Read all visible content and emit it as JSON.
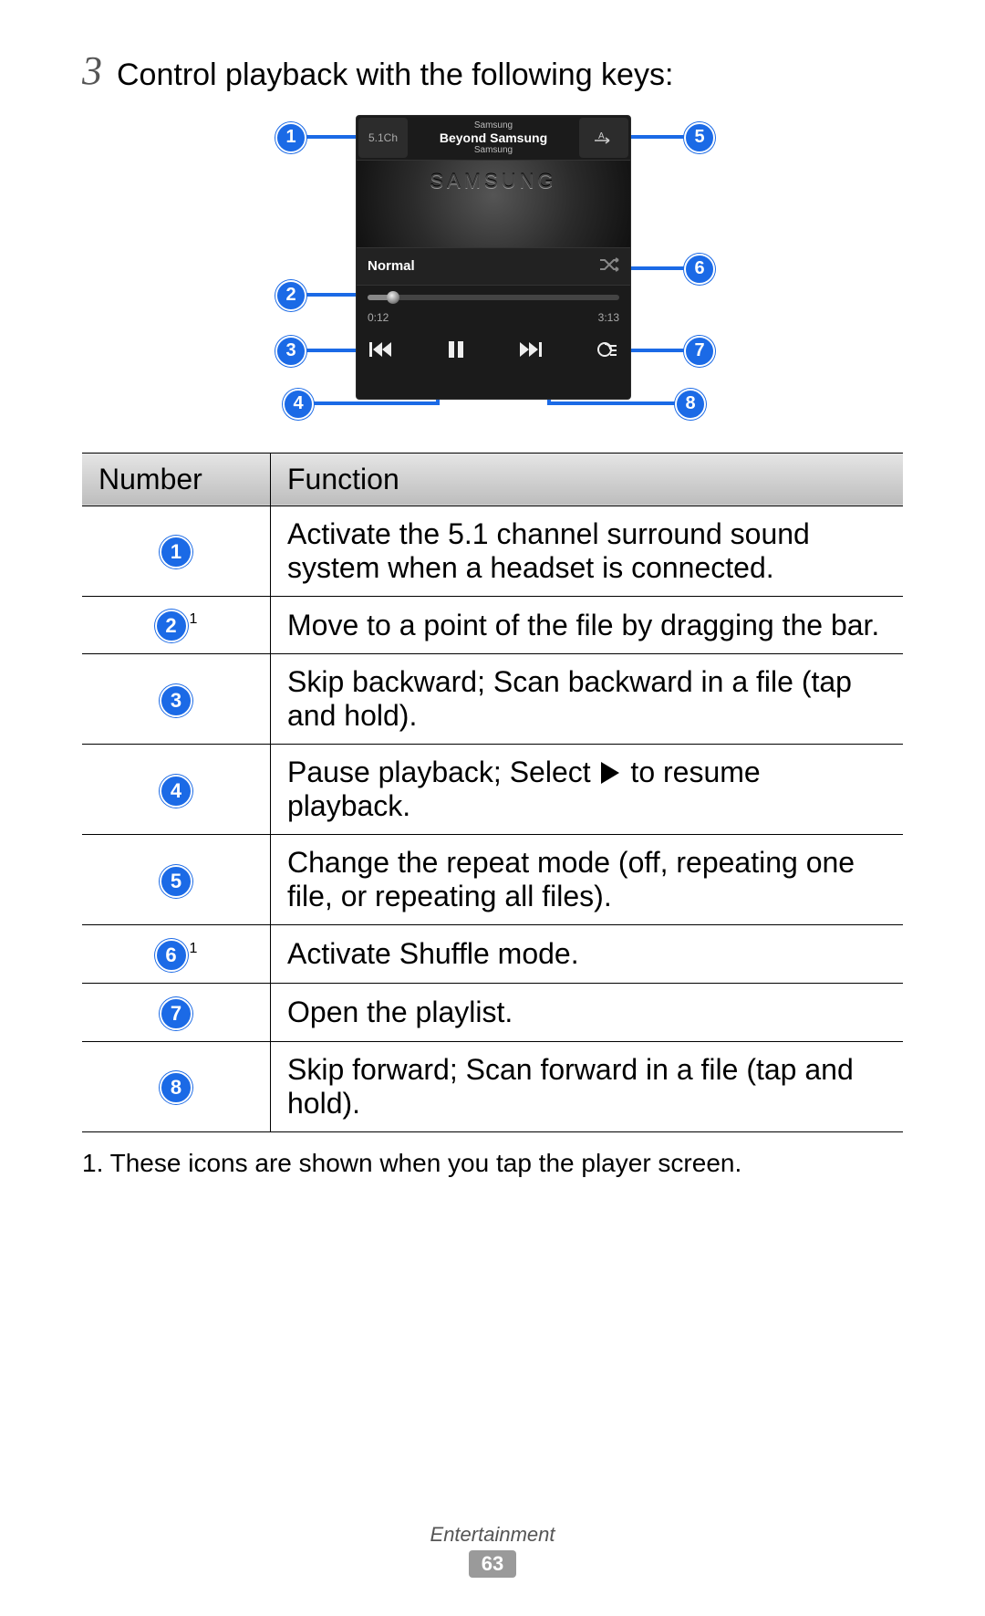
{
  "step": {
    "number": "3",
    "text": "Control playback with the following keys:"
  },
  "player": {
    "artist_top": "Samsung",
    "song": "Beyond Samsung",
    "album": "Samsung",
    "brand_art": "SAMSUNG",
    "btn51_label": "5.1Ch",
    "repeat_label": "A",
    "eq_label": "Normal",
    "time_elapsed": "0:12",
    "time_total": "3:13"
  },
  "callouts": [
    "1",
    "2",
    "3",
    "4",
    "5",
    "6",
    "7",
    "8"
  ],
  "table": {
    "headers": {
      "number": "Number",
      "function": "Function"
    },
    "rows": [
      {
        "badge": "1",
        "sup": "",
        "desc": "Activate the 5.1 channel surround sound system when a headset is connected."
      },
      {
        "badge": "2",
        "sup": "1",
        "desc": "Move to a point of the file by dragging the bar."
      },
      {
        "badge": "3",
        "sup": "",
        "desc": "Skip backward; Scan backward in a file (tap and hold)."
      },
      {
        "badge": "4",
        "sup": "",
        "desc_pre": "Pause playback; Select ",
        "desc_post": " to resume playback."
      },
      {
        "badge": "5",
        "sup": "",
        "desc": "Change the repeat mode (off, repeating one file, or repeating all files)."
      },
      {
        "badge": "6",
        "sup": "1",
        "desc": "Activate Shuffle mode."
      },
      {
        "badge": "7",
        "sup": "",
        "desc": "Open the playlist."
      },
      {
        "badge": "8",
        "sup": "",
        "desc": "Skip forward; Scan forward in a file (tap and hold)."
      }
    ]
  },
  "footnote": "1.  These icons are shown when you tap the player screen.",
  "footer": {
    "section": "Entertainment",
    "page": "63"
  }
}
